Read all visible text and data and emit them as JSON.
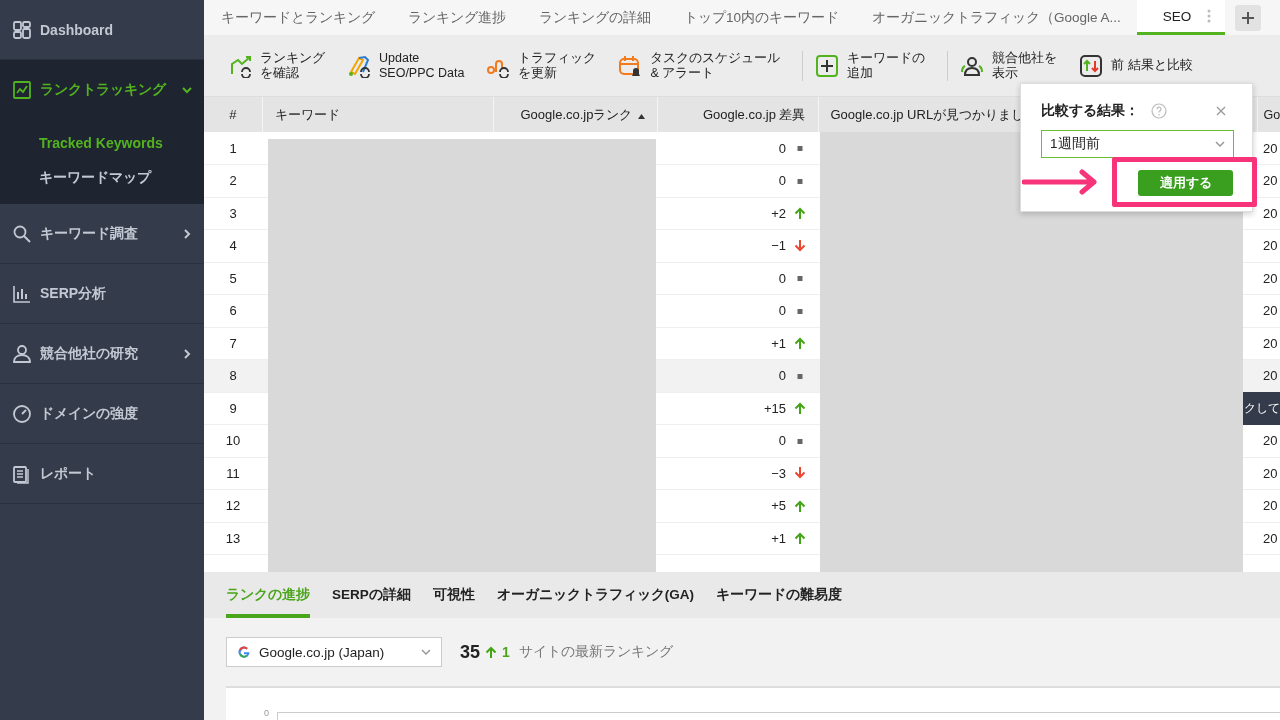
{
  "sidebar": {
    "items": [
      {
        "label": "Dashboard",
        "selected": false
      },
      {
        "label": "ランクトラッキング",
        "selected": true,
        "expanded": true,
        "children": [
          {
            "label": "Tracked Keywords",
            "selected": true
          },
          {
            "label": "キーワードマップ",
            "selected": false
          }
        ]
      },
      {
        "label": "キーワード調査",
        "selected": false,
        "expanded": false
      },
      {
        "label": "SERP分析",
        "selected": false
      },
      {
        "label": "競合他社の研究",
        "selected": false,
        "expanded": false
      },
      {
        "label": "ドメインの強度",
        "selected": false
      },
      {
        "label": "レポート",
        "selected": false
      }
    ]
  },
  "tabs": [
    {
      "label": "キーワードとランキング",
      "selected": false
    },
    {
      "label": "ランキング進捗",
      "selected": false
    },
    {
      "label": "ランキングの詳細",
      "selected": false
    },
    {
      "label": "トップ10内のキーワード",
      "selected": false
    },
    {
      "label": "オーガニックトラフィック（Google A...",
      "selected": false
    },
    {
      "label": "SEO",
      "selected": true
    }
  ],
  "toolbar": [
    {
      "lines": [
        "ランキング",
        "を確認"
      ]
    },
    {
      "lines": [
        "Update",
        "SEO/PPC Data"
      ]
    },
    {
      "lines": [
        "トラフィック",
        "を更新"
      ]
    },
    {
      "lines": [
        "タスクのスケジュール",
        "& アラート"
      ]
    },
    {
      "lines": [
        "キーワードの",
        "追加"
      ]
    },
    {
      "lines": [
        "競合他社を",
        "表示"
      ]
    },
    {
      "lines": [
        "前 結果と比較"
      ]
    }
  ],
  "table": {
    "columns": [
      {
        "label": "#",
        "sorted": false
      },
      {
        "label": "キーワード",
        "sorted": false
      },
      {
        "label": "Google.co.jpランク",
        "sorted": true
      },
      {
        "label": "Google.co.jp 差異",
        "sorted": false
      },
      {
        "label": "Google.co.jp URLが見つかりまし",
        "sorted": false
      },
      {
        "label": "Go",
        "sorted": false
      }
    ],
    "rows": [
      {
        "num": "1",
        "change": "0",
        "kind": "flat",
        "highlighted": false,
        "column_6": "20"
      },
      {
        "num": "2",
        "change": "0",
        "kind": "flat",
        "highlighted": false,
        "column_6": "20"
      },
      {
        "num": "3",
        "change": "+2",
        "kind": "up",
        "highlighted": false,
        "column_6": "20"
      },
      {
        "num": "4",
        "change": "−1",
        "kind": "down",
        "highlighted": false,
        "column_6": "20"
      },
      {
        "num": "5",
        "change": "0",
        "kind": "flat",
        "highlighted": false,
        "column_6": "20"
      },
      {
        "num": "6",
        "change": "0",
        "kind": "flat",
        "highlighted": false,
        "column_6": "20"
      },
      {
        "num": "7",
        "change": "+1",
        "kind": "up",
        "highlighted": false,
        "column_6": "20"
      },
      {
        "num": "8",
        "change": "0",
        "kind": "flat",
        "highlighted": true,
        "column_6": "20"
      },
      {
        "num": "9",
        "change": "+15",
        "kind": "up",
        "highlighted": false
      },
      {
        "num": "10",
        "change": "0",
        "kind": "flat",
        "highlighted": false,
        "column_6": "20"
      },
      {
        "num": "11",
        "change": "−3",
        "kind": "down",
        "highlighted": false,
        "column_6": "20"
      },
      {
        "num": "12",
        "change": "+5",
        "kind": "up",
        "highlighted": false,
        "column_6": "20"
      },
      {
        "num": "13",
        "change": "+1",
        "kind": "up",
        "highlighted": false,
        "column_6": "20"
      }
    ],
    "tooltip": "クして"
  },
  "compare_popup": {
    "title": "比較する結果：",
    "select_value": "1週間前",
    "apply_button": "適用する"
  },
  "bottom_panel": {
    "tabs": [
      {
        "label": "ランクの進捗",
        "selected": true
      },
      {
        "label": "SERPの詳細",
        "selected": false
      },
      {
        "label": "可視性",
        "selected": false
      },
      {
        "label": "オーガニックトラフィック(GA)",
        "selected": false
      },
      {
        "label": "キーワードの難易度",
        "selected": false
      }
    ],
    "engine": "Google.co.jp (Japan)",
    "rank": "35",
    "rank_change": "1",
    "caption": "サイトの最新ランキング",
    "chart_tick": "0"
  }
}
